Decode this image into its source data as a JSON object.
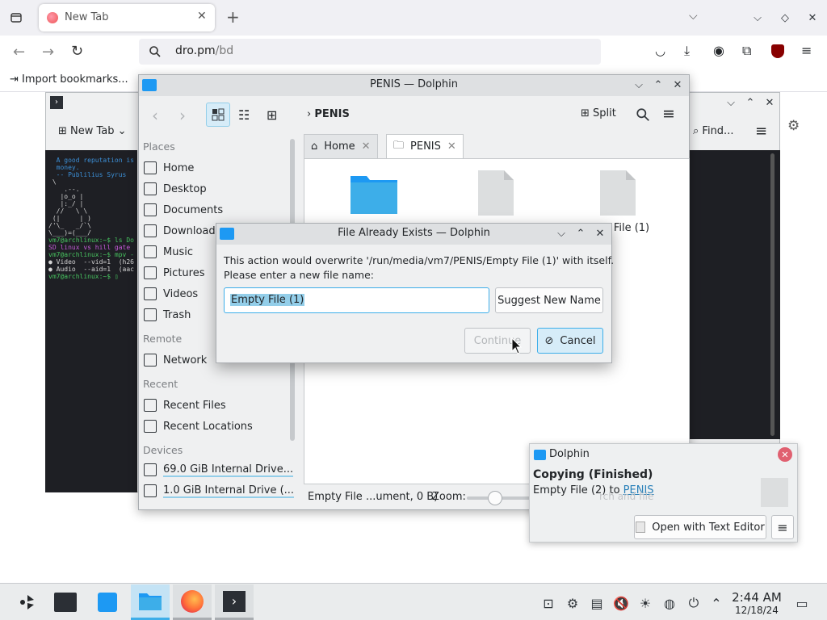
{
  "firefox": {
    "tab_title": "New Tab",
    "url_host": "dro.pm",
    "url_path": "/bd",
    "bookmarks_import": "Import bookmarks..."
  },
  "terminal": {
    "new_tab": "New Tab",
    "find": "Find...",
    "lines": [
      "  A good reputation is",
      "  money.",
      "",
      "  -- Publilius Syrus",
      "",
      "",
      " \\",
      "    .--.",
      "   |o_o |",
      "   |:_/ |",
      "  //   \\ \\",
      " (|     | )",
      "/'\\_   _/`\\",
      "\\___)=(___/",
      "",
      "vm7@archlinux:~$ ls Do",
      "SD linux vs hill gate",
      "vm7@archlinux:~$ mpv -",
      "● Video  --vid=1  (h26",
      "● Audio  --aid=1  (aac",
      "vm7@archlinux:~$ ▯"
    ]
  },
  "dolphin": {
    "title": "PENIS — Dolphin",
    "breadcrumb": "PENIS",
    "split": "Split",
    "places_header": "Places",
    "remote_header": "Remote",
    "recent_header": "Recent",
    "devices_header": "Devices",
    "places": [
      {
        "label": "Home",
        "icon": "home-icon"
      },
      {
        "label": "Desktop",
        "icon": "desktop-icon"
      },
      {
        "label": "Documents",
        "icon": "documents-icon"
      },
      {
        "label": "Downloads",
        "icon": "download-icon"
      },
      {
        "label": "Music",
        "icon": "music-icon"
      },
      {
        "label": "Pictures",
        "icon": "pictures-icon"
      },
      {
        "label": "Videos",
        "icon": "videos-icon"
      },
      {
        "label": "Trash",
        "icon": "trash-icon"
      }
    ],
    "remote": [
      {
        "label": "Network",
        "icon": "network-icon"
      }
    ],
    "recent": [
      {
        "label": "Recent Files",
        "icon": "recent-files-icon"
      },
      {
        "label": "Recent Locations",
        "icon": "recent-locations-icon"
      }
    ],
    "devices": [
      {
        "label": "69.0 GiB Internal Drive...",
        "icon": "drive-icon"
      },
      {
        "label": "1.0 GiB Internal Drive (...",
        "icon": "drive-icon"
      }
    ],
    "tabs": [
      {
        "label": "Home"
      },
      {
        "label": "PENIS"
      }
    ],
    "files": [
      {
        "label": "",
        "type": "folder"
      },
      {
        "label": "",
        "type": "file"
      },
      {
        "label": "y File (1)",
        "type": "file"
      }
    ],
    "status": "Empty File ...ument, 0 B)",
    "zoom_label": "Zoom:"
  },
  "dialog": {
    "title": "File Already Exists — Dolphin",
    "message_line1": "This action would overwrite '/run/media/vm7/PENIS/Empty File (1)' with itself.",
    "message_line2": "Please enter a new file name:",
    "filename_value": "Empty File (1)",
    "suggest_label": "Suggest New Name",
    "continue_label": "Continue",
    "cancel_label": "Cancel"
  },
  "notification": {
    "app": "Dolphin",
    "title": "Copying (Finished)",
    "body_prefix": "Empty File (2) to ",
    "body_link": "PENIS",
    "action": "Open with Text Editor",
    "behind_text": "rch and file"
  },
  "taskbar": {
    "time": "2:44 AM",
    "date": "12/18/24"
  },
  "colors": {
    "accent": "#3daee9",
    "folder": "#1d99f3",
    "link": "#2980b9",
    "selection": "#93cee9"
  }
}
